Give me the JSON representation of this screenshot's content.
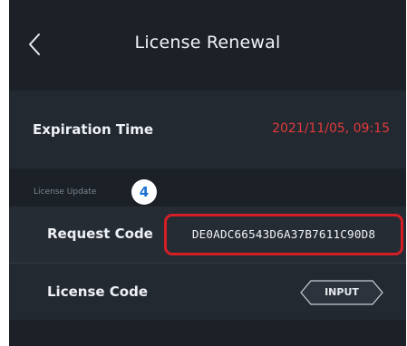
{
  "header": {
    "title": "License Renewal",
    "back_icon": "chevron-left-icon"
  },
  "expiration": {
    "label": "Expiration Time",
    "value": "2021/11/05, 09:15",
    "value_color": "#e23a3a"
  },
  "license_update": {
    "section_label": "License Update",
    "step_badge": "4",
    "request_code": {
      "label": "Request Code",
      "value": "DE0ADC66543D6A37B7611C90D8",
      "highlight_color": "#d41f26"
    },
    "license_code": {
      "label": "License Code",
      "button_label": "INPUT"
    }
  }
}
